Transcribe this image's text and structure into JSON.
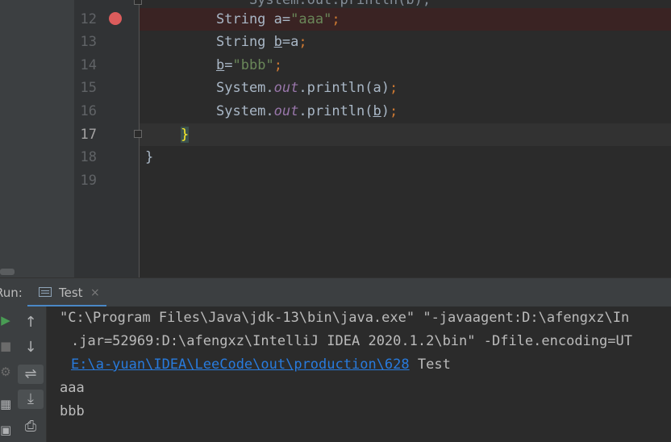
{
  "editor": {
    "partial_top": "    System.out.println(b);",
    "line_numbers": [
      "12",
      "13",
      "14",
      "15",
      "16",
      "17",
      "18",
      "19"
    ],
    "lines": {
      "l12": {
        "pre": "String a=",
        "str": "\"aaa\"",
        "semi": ";"
      },
      "l13": {
        "pre": "String ",
        "var": "b",
        "mid": "=a",
        "semi": ";"
      },
      "l14": {
        "var": "b",
        "mid": "=",
        "str": "\"bbb\"",
        "semi": ";"
      },
      "l15": {
        "pre": "System.",
        "out": "out",
        "mid": ".println(a)",
        "semi": ";"
      },
      "l16": {
        "pre": "System.",
        "out": "out",
        "mid": ".println(",
        "var": "b",
        "end": ")",
        "semi": ";"
      },
      "l17": {
        "brace": "}"
      },
      "l18": {
        "brace": "}"
      }
    },
    "colors": {
      "string": "#6a8759",
      "keyword": "#cc7832",
      "field": "#9876aa",
      "breakpoint": "#db5c5c",
      "brace_match": "#ffef28"
    }
  },
  "run_panel": {
    "label": "Run:",
    "tab_label": "Test",
    "tab_close": "×",
    "console": {
      "line1": "\"C:\\Program Files\\Java\\jdk-13\\bin\\java.exe\" \"-javaagent:D:\\afengxz\\In",
      "line2": ".jar=52969:D:\\afengxz\\IntelliJ IDEA 2020.1.2\\bin\" -Dfile.encoding=UT",
      "line3_link": "E:\\a-yuan\\IDEA\\LeeCode\\out\\production\\628",
      "line3_rest": " Test",
      "line4": "aaa",
      "line5": "bbb"
    },
    "toolbar": {
      "up": "↑",
      "down": "↓",
      "wrap": "⇌",
      "scroll_end": "⤓",
      "print": "⎙"
    }
  }
}
